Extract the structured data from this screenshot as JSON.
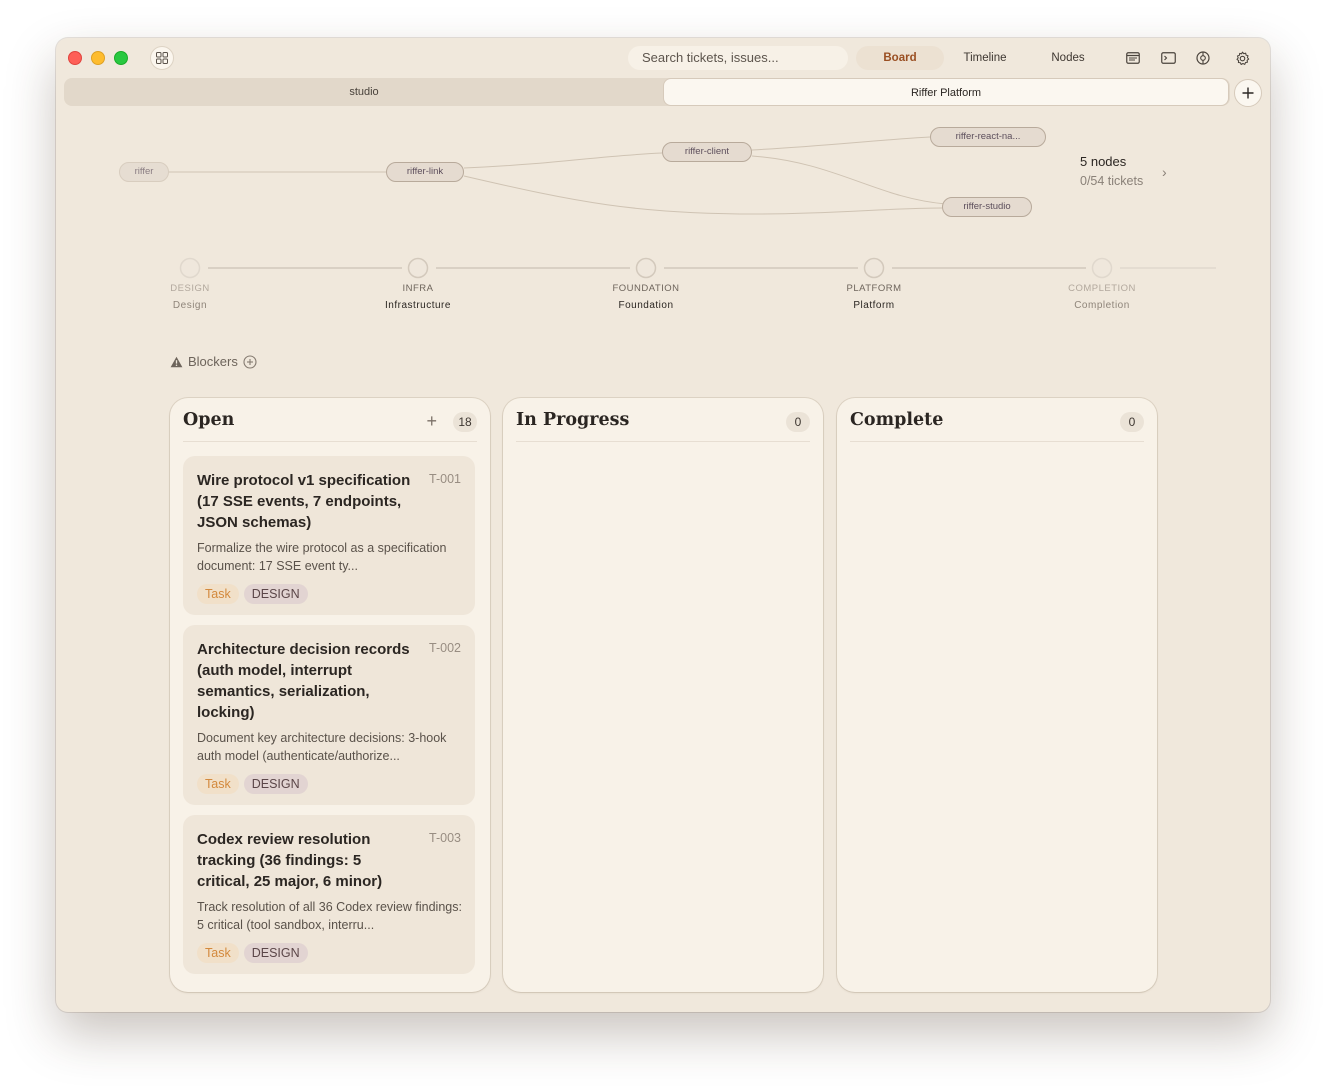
{
  "toolbar": {
    "search_placeholder": "Search tickets, issues...",
    "views": [
      "Board",
      "Timeline",
      "Nodes"
    ],
    "active_view": "Board",
    "icons": [
      "window-icon",
      "terminal-icon",
      "network-icon",
      "gear-icon"
    ]
  },
  "tabs": [
    {
      "label": "studio",
      "active": false
    },
    {
      "label": "Riffer Platform",
      "active": true
    }
  ],
  "graph": {
    "nodes": [
      "riffer",
      "riffer-link",
      "riffer-client",
      "riffer-react-na...",
      "riffer-studio"
    ],
    "summary": {
      "nodes": "5 nodes",
      "tickets": "0/54 tickets"
    }
  },
  "phases": [
    {
      "code": "DESIGN",
      "name": "Design"
    },
    {
      "code": "INFRA",
      "name": "Infrastructure"
    },
    {
      "code": "FOUNDATION",
      "name": "Foundation"
    },
    {
      "code": "PLATFORM",
      "name": "Platform"
    },
    {
      "code": "COMPLETION",
      "name": "Completion"
    }
  ],
  "blockers": {
    "label": "Blockers"
  },
  "columns": [
    {
      "title": "Open",
      "count": "18",
      "cards": [
        {
          "id": "T-001",
          "title": "Wire protocol v1 specification (17 SSE events, 7 endpoints, JSON schemas)",
          "desc": "Formalize the wire protocol as a specification document: 17 SSE event ty...",
          "tags": [
            "Task",
            "DESIGN"
          ]
        },
        {
          "id": "T-002",
          "title": "Architecture decision records (auth model, interrupt semantics, serialization, locking)",
          "desc": "Document key architecture decisions: 3-hook auth model (authenticate/authorize...",
          "tags": [
            "Task",
            "DESIGN"
          ]
        },
        {
          "id": "T-003",
          "title": "Codex review resolution tracking (36 findings: 5 critical, 25 major, 6 minor)",
          "desc": "Track resolution of all 36 Codex review findings: 5 critical (tool sandbox, interru...",
          "tags": [
            "Task",
            "DESIGN"
          ]
        }
      ]
    },
    {
      "title": "In Progress",
      "count": "0",
      "cards": []
    },
    {
      "title": "Complete",
      "count": "0",
      "cards": []
    }
  ],
  "colors": {
    "window_bg": "#f0e8dc",
    "accent": "#9a4f22",
    "task_tag": "#d3893d",
    "design_tag_bg": "#e2d4d2"
  }
}
